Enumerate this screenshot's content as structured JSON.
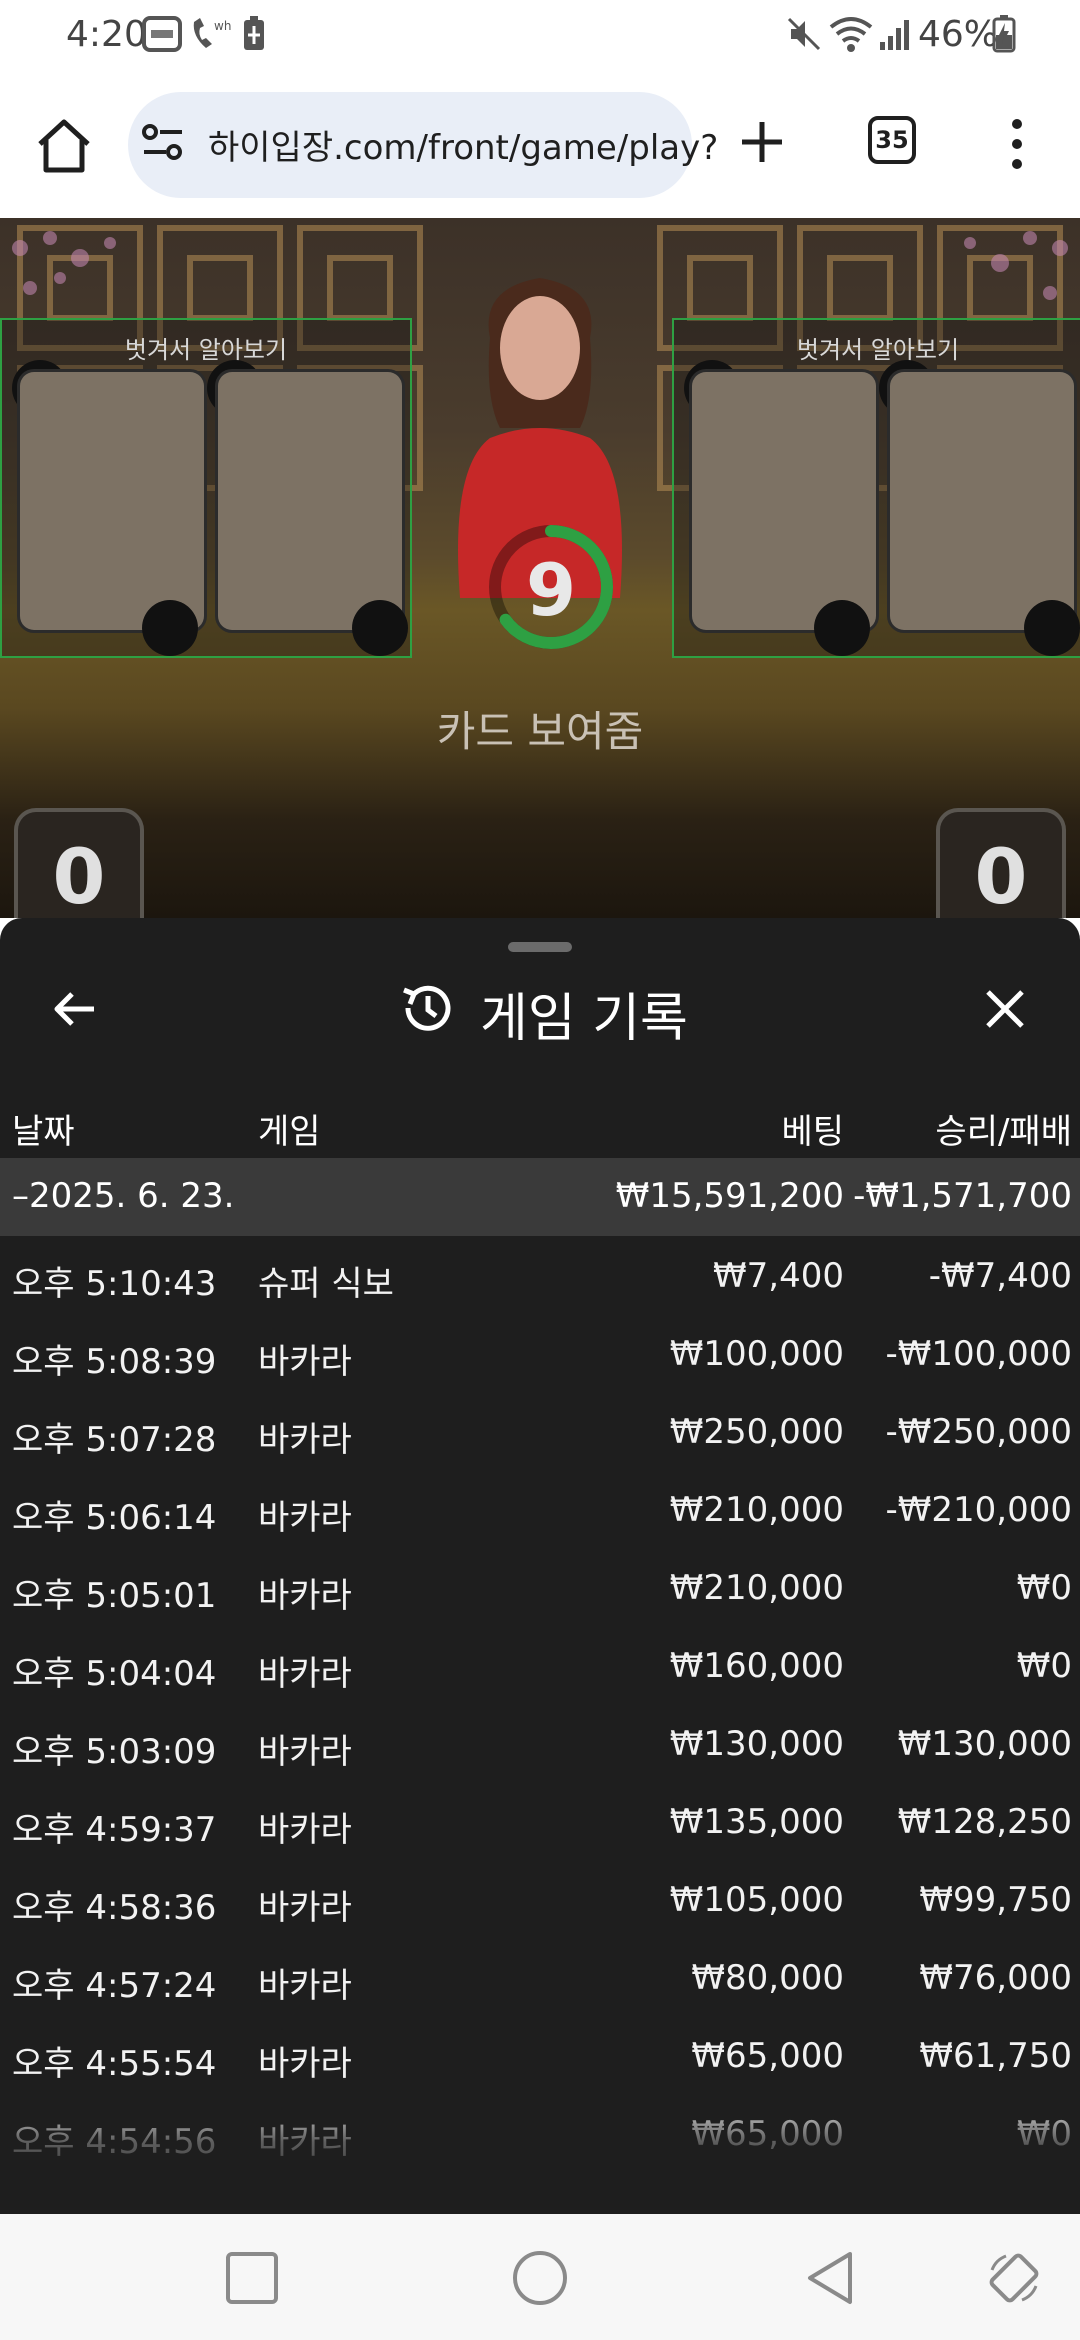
{
  "status_bar": {
    "time": "4:20",
    "icons": [
      "app-badge-icon",
      "wifi-call-icon",
      "battery-saver-icon",
      "mute-icon",
      "wifi-icon",
      "signal-icon",
      "battery-charging-icon"
    ],
    "battery": "46%"
  },
  "browser": {
    "url": "하이입장.com/front/game/play?",
    "tab_count": "35",
    "icons": [
      "home-icon",
      "site-settings-icon",
      "new-tab-icon",
      "more-icon"
    ]
  },
  "game": {
    "peel_label_left": "벗겨서 알아보기",
    "peel_label_right": "벗겨서 알아보기",
    "timer_value": "9",
    "timer_progress": 0.65,
    "card_status": "카드 보여줌",
    "player_score": "0",
    "banker_score": "0",
    "accent_color": "#2ea043"
  },
  "history": {
    "title": "게임 기록",
    "columns": {
      "date": "날짜",
      "game": "게임",
      "bet": "베팅",
      "winloss": "승리/패배"
    },
    "day": {
      "date": "–2025. 6. 23.",
      "bet": "₩15,591,200",
      "winloss": "-₩1,571,700"
    },
    "rows": [
      {
        "time": "오후 5:10:43",
        "game": "슈퍼 식보",
        "bet": "₩7,400",
        "winloss": "-₩7,400"
      },
      {
        "time": "오후 5:08:39",
        "game": "바카라",
        "bet": "₩100,000",
        "winloss": "-₩100,000"
      },
      {
        "time": "오후 5:07:28",
        "game": "바카라",
        "bet": "₩250,000",
        "winloss": "-₩250,000"
      },
      {
        "time": "오후 5:06:14",
        "game": "바카라",
        "bet": "₩210,000",
        "winloss": "-₩210,000"
      },
      {
        "time": "오후 5:05:01",
        "game": "바카라",
        "bet": "₩210,000",
        "winloss": "₩0"
      },
      {
        "time": "오후 5:04:04",
        "game": "바카라",
        "bet": "₩160,000",
        "winloss": "₩0"
      },
      {
        "time": "오후 5:03:09",
        "game": "바카라",
        "bet": "₩130,000",
        "winloss": "₩130,000"
      },
      {
        "time": "오후 4:59:37",
        "game": "바카라",
        "bet": "₩135,000",
        "winloss": "₩128,250"
      },
      {
        "time": "오후 4:58:36",
        "game": "바카라",
        "bet": "₩105,000",
        "winloss": "₩99,750"
      },
      {
        "time": "오후 4:57:24",
        "game": "바카라",
        "bet": "₩80,000",
        "winloss": "₩76,000"
      },
      {
        "time": "오후 4:55:54",
        "game": "바카라",
        "bet": "₩65,000",
        "winloss": "₩61,750"
      },
      {
        "time": "오후 4:54:56",
        "game": "바카라",
        "bet": "₩65,000",
        "winloss": "₩0"
      }
    ]
  },
  "nav": {
    "icons": [
      "recents-icon",
      "home-circle-icon",
      "back-triangle-icon",
      "rotate-icon"
    ]
  }
}
